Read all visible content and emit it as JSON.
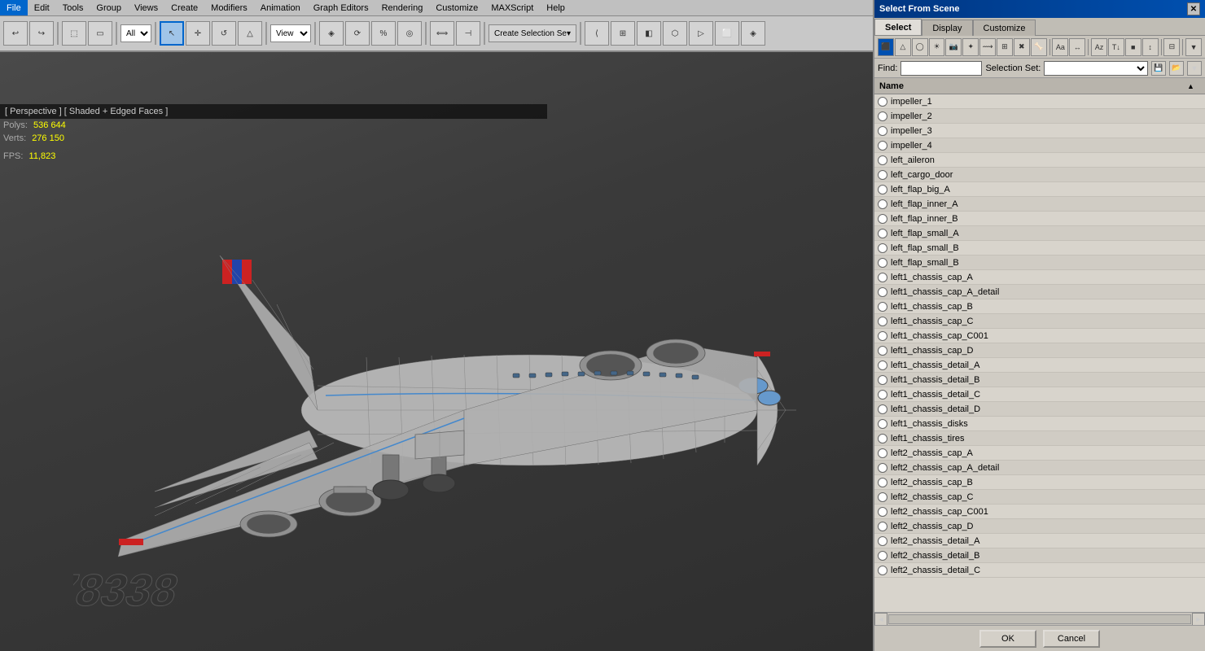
{
  "menubar": {
    "items": [
      "File",
      "Edit",
      "Tools",
      "Group",
      "Views",
      "Create",
      "Modifiers",
      "Animation",
      "Graph Editors",
      "Rendering",
      "Customize",
      "MAXScript",
      "Help"
    ]
  },
  "toolbar": {
    "mode_label": "All",
    "view_label": "View"
  },
  "viewport": {
    "label": "[ Perspective ] [ Shaded + Edged Faces ]",
    "stats": {
      "polys_label": "Polys:",
      "polys_value": "536 644",
      "verts_label": "Verts:",
      "verts_value": "276 150",
      "fps_label": "FPS:",
      "fps_value": "11,823"
    }
  },
  "panel": {
    "title": "Select From Scene",
    "close_btn": "✕",
    "tabs": [
      "Select",
      "Display",
      "Customize"
    ],
    "active_tab": "Select",
    "find_label": "Find:",
    "find_placeholder": "",
    "sel_set_label": "Selection Set:",
    "ok_label": "OK",
    "cancel_label": "Cancel",
    "name_header": "Name",
    "objects": [
      "impeller_1",
      "impeller_2",
      "impeller_3",
      "impeller_4",
      "left_aileron",
      "left_cargo_door",
      "left_flap_big_A",
      "left_flap_inner_A",
      "left_flap_inner_B",
      "left_flap_small_A",
      "left_flap_small_B",
      "left_flap_small_B",
      "left1_chassis_cap_A",
      "left1_chassis_cap_A_detail",
      "left1_chassis_cap_B",
      "left1_chassis_cap_C",
      "left1_chassis_cap_C001",
      "left1_chassis_cap_D",
      "left1_chassis_detail_A",
      "left1_chassis_detail_B",
      "left1_chassis_detail_C",
      "left1_chassis_detail_D",
      "left1_chassis_disks",
      "left1_chassis_tires",
      "left2_chassis_cap_A",
      "left2_chassis_cap_A_detail",
      "left2_chassis_cap_B",
      "left2_chassis_cap_C",
      "left2_chassis_cap_C001",
      "left2_chassis_cap_D",
      "left2_chassis_detail_A",
      "left2_chassis_detail_B",
      "left2_chassis_detail_C"
    ]
  }
}
